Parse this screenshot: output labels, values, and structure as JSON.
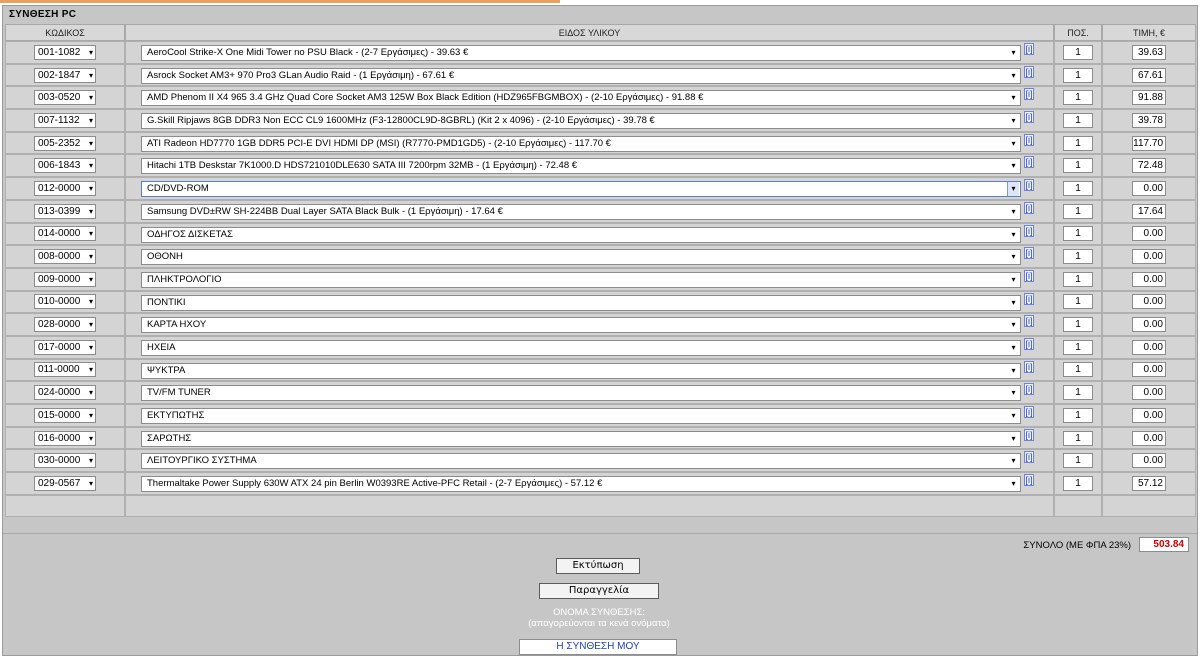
{
  "panel": {
    "title": "ΣΥΝΘΕΣΗ PC"
  },
  "columns": {
    "code": "ΚΩΔΙΚΟΣ",
    "item": "ΕΙΔΟΣ ΥΛΙΚΟΥ",
    "qty": "ΠΟΣ.",
    "price": "ΤΙΜΗ, €"
  },
  "rows": [
    {
      "code": "001-1082",
      "item": "AeroCool Strike-X One Midi Tower no PSU Black - (2-7 Εργάσιμες) - 39.63 €",
      "qty": "1",
      "price": "39.63"
    },
    {
      "code": "002-1847",
      "item": "Asrock Socket AM3+ 970 Pro3 GLan Audio Raid - (1 Εργάσιμη) - 67.61 €",
      "qty": "1",
      "price": "67.61"
    },
    {
      "code": "003-0520",
      "item": "AMD Phenom II X4 965 3.4 GHz Quad Core Socket AM3 125W Box Black Edition (HDZ965FBGMBOX) - (2-10 Εργάσιμες) - 91.88 €",
      "qty": "1",
      "price": "91.88"
    },
    {
      "code": "007-1132",
      "item": "G.Skill Ripjaws 8GB DDR3 Non ECC CL9 1600MHz (F3-12800CL9D-8GBRL) (Kit 2 x 4096) - (2-10 Εργάσιμες) - 39.78 €",
      "qty": "1",
      "price": "39.78"
    },
    {
      "code": "005-2352",
      "item": "ATI Radeon HD7770 1GB DDR5 PCI-E DVI HDMI DP (MSI) (R7770-PMD1GD5) - (2-10 Εργάσιμες) - 117.70 €",
      "qty": "1",
      "price": "117.70"
    },
    {
      "code": "006-1843",
      "item": "Hitachi 1TB Deskstar 7K1000.D HDS721010DLE630 SATA III 7200rpm 32MB - (1 Εργάσιμη) - 72.48 €",
      "qty": "1",
      "price": "72.48"
    },
    {
      "code": "012-0000",
      "item": "CD/DVD-ROM",
      "qty": "1",
      "price": "0.00",
      "focused": true
    },
    {
      "code": "013-0399",
      "item": "Samsung DVD±RW SH-224BB Dual Layer SATA Black Bulk - (1 Εργάσιμη) - 17.64 €",
      "qty": "1",
      "price": "17.64"
    },
    {
      "code": "014-0000",
      "item": "ΟΔΗΓΟΣ ΔΙΣΚΕΤΑΣ",
      "qty": "1",
      "price": "0.00"
    },
    {
      "code": "008-0000",
      "item": "ΟΘΟΝΗ",
      "qty": "1",
      "price": "0.00"
    },
    {
      "code": "009-0000",
      "item": "ΠΛΗΚΤΡΟΛΟΓΙΟ",
      "qty": "1",
      "price": "0.00"
    },
    {
      "code": "010-0000",
      "item": "ΠΟΝΤΙΚΙ",
      "qty": "1",
      "price": "0.00"
    },
    {
      "code": "028-0000",
      "item": "ΚΑΡΤΑ ΗΧΟΥ",
      "qty": "1",
      "price": "0.00"
    },
    {
      "code": "017-0000",
      "item": "ΗΧΕΙΑ",
      "qty": "1",
      "price": "0.00"
    },
    {
      "code": "011-0000",
      "item": "ΨΥΚΤΡΑ",
      "qty": "1",
      "price": "0.00"
    },
    {
      "code": "024-0000",
      "item": "TV/FM TUNER",
      "qty": "1",
      "price": "0.00"
    },
    {
      "code": "015-0000",
      "item": "ΕΚΤΥΠΩΤΗΣ",
      "qty": "1",
      "price": "0.00"
    },
    {
      "code": "016-0000",
      "item": "ΣΑΡΩΤΗΣ",
      "qty": "1",
      "price": "0.00"
    },
    {
      "code": "030-0000",
      "item": "ΛΕΙΤΟΥΡΓΙΚΟ ΣΥΣΤΗΜΑ",
      "qty": "1",
      "price": "0.00"
    },
    {
      "code": "029-0567",
      "item": "Thermaltake Power Supply 630W ATX 24 pin Berlin W0393RE Active-PFC Retail - (2-7 Εργάσιμες) - 57.12 €",
      "qty": "1",
      "price": "57.12"
    }
  ],
  "info_glyph": "[i]",
  "dropdown_glyph": "▾",
  "total": {
    "label": "ΣΥΝΟΛΟ (ΜΕ ΦΠΑ 23%)",
    "value": "503.84"
  },
  "actions": {
    "print_label": "Εκτύπωση",
    "order_label": "Παραγγελία"
  },
  "composition": {
    "name_label": "ΟΝΟΜΑ ΣΥΝΘΕΣΗΣ:",
    "name_hint": "(απαγορεύονται τα κενά ονόματα)",
    "name_value": "Η ΣΥΝΘΕΣΗ ΜΟΥ"
  },
  "colors": {
    "total_value": "#cc0000",
    "info_icon": "#1a3fd0",
    "name_value": "#1e3fb8",
    "panel_bg": "#c6c6c6"
  }
}
